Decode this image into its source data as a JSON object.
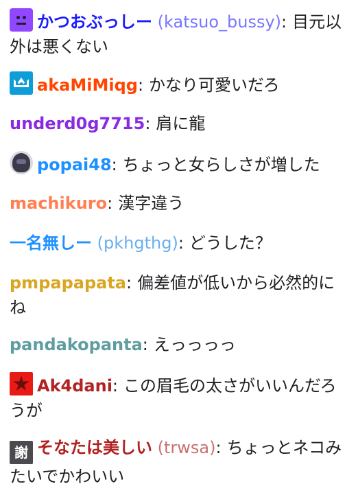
{
  "messages": [
    {
      "badge": "purple-face-icon",
      "username": "かつおぶっしー",
      "login": "(katsuo_bussy)",
      "color": "#1a1aff",
      "login_color": "#7777ff",
      "separator": ":",
      "text": "目元以外は悪くない"
    },
    {
      "badge": "prime-crown-icon",
      "username": "akaMiMiqg",
      "color": "#ff4500",
      "separator": ":",
      "text": "かなり可愛いだろ"
    },
    {
      "username": "underd0g7715",
      "color": "#8a2be2",
      "separator": ":",
      "text": "肩に龍"
    },
    {
      "badge": "avatar-icon",
      "username": "popai48",
      "color": "#1e90ff",
      "separator": ":",
      "text": "ちょっと女らしさが増した"
    },
    {
      "username": "machikuro",
      "color": "#ff7f50",
      "separator": ":",
      "text": "漢字違う"
    },
    {
      "username": "一名無しー",
      "login": "(pkhgthg)",
      "color": "#1e90ff",
      "login_color": "#6aaef0",
      "separator": ":",
      "text": "どうした？"
    },
    {
      "username": "pmpapapata",
      "color": "#daa520",
      "separator": ":",
      "text": "偏差値が低いから必然的にね"
    },
    {
      "username": "pandakopanta",
      "color": "#5f9ea0",
      "separator": ":",
      "text": "えっっっっ"
    },
    {
      "badge": "red-star-icon",
      "username": "Ak4dani",
      "color": "#b22222",
      "separator": ":",
      "text": "この眉毛の太さがいいんだろうが"
    },
    {
      "badge": "kanji-badge-icon",
      "badge_text": "謝",
      "username": "そなたは美しい",
      "login": "(trwsa)",
      "color": "#b22222",
      "login_color": "#c87070",
      "separator": ":",
      "text": "ちょっとネコみたいでかわいい"
    }
  ]
}
